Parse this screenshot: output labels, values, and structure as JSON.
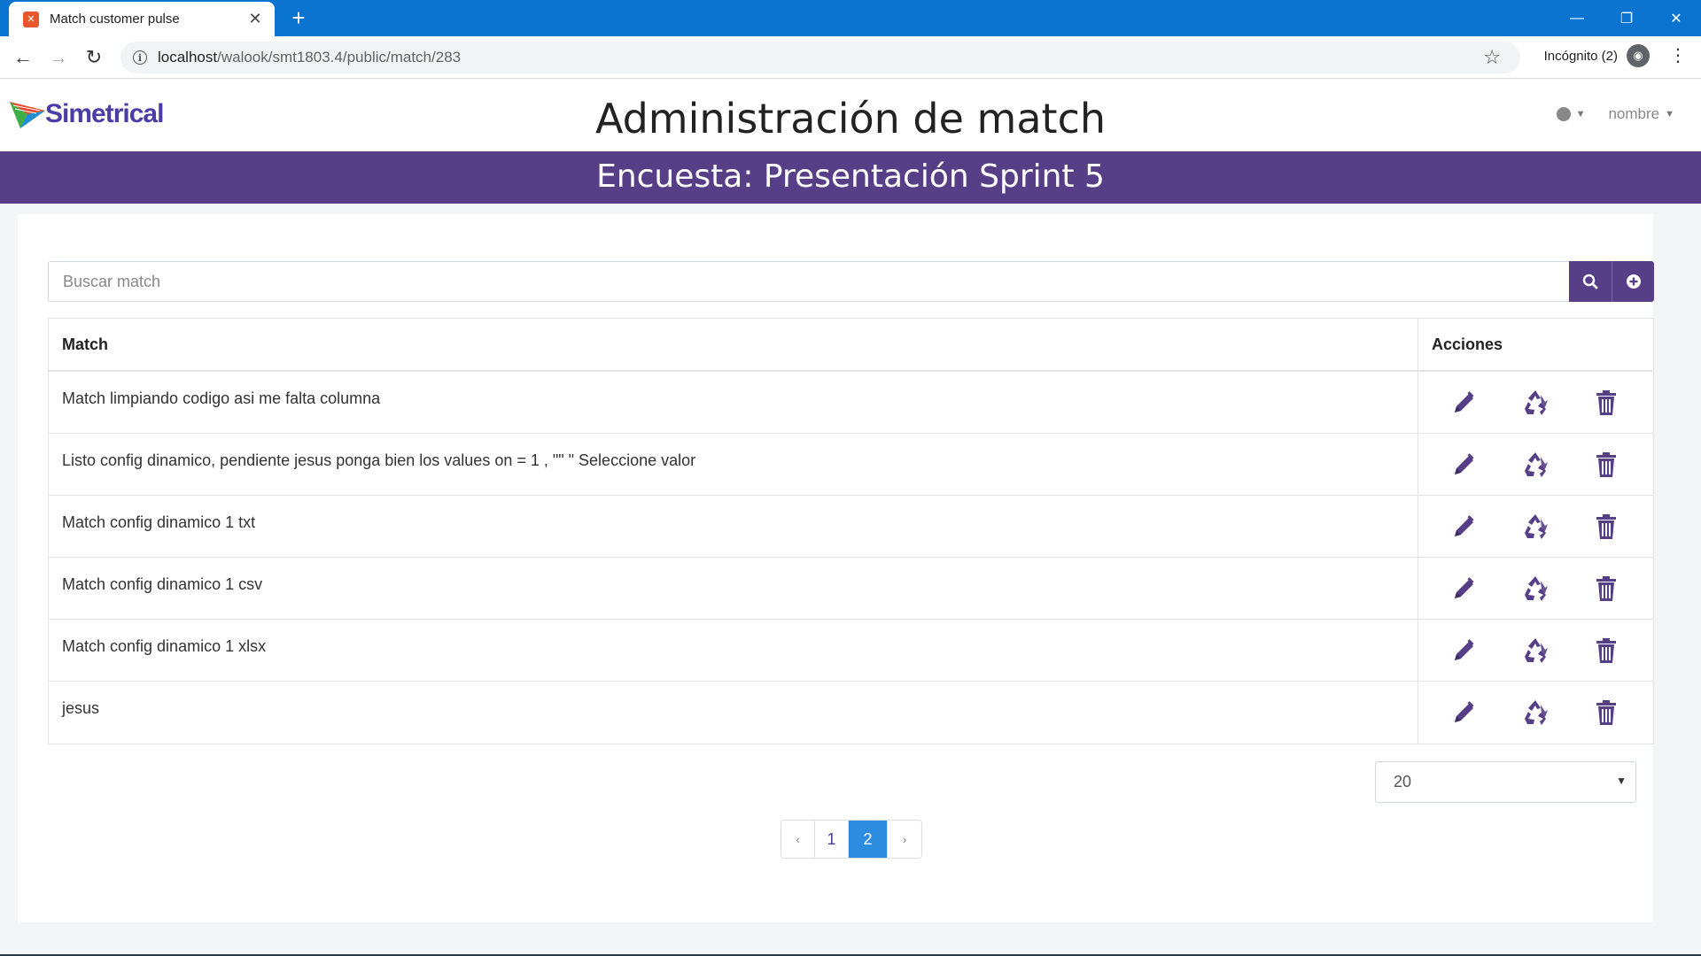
{
  "browser": {
    "tab_title": "Match customer pulse",
    "url_host": "localhost",
    "url_path": "/walook/smt1803.4/public/match/283",
    "incognito_label": "Incógnito (2)"
  },
  "header": {
    "logo_text": "Simetrical",
    "title": "Administración de match",
    "user_label": "nombre"
  },
  "banner": {
    "text": "Encuesta: Presentación Sprint 5"
  },
  "search": {
    "placeholder": "Buscar match"
  },
  "table": {
    "col_match": "Match",
    "col_actions": "Acciones",
    "rows": [
      "Match limpiando codigo asi me falta columna",
      "Listo config dinamico, pendiente jesus ponga bien los values on = 1 , \"\" \" Seleccione valor",
      "Match config dinamico 1 txt",
      "Match config dinamico 1 csv",
      "Match config dinamico 1 xlsx",
      "jesus"
    ]
  },
  "pager": {
    "page_size": "20",
    "prev": "‹",
    "next": "›",
    "pages": [
      "1",
      "2"
    ],
    "current_page": "2"
  },
  "colors": {
    "brand_purple": "#573f88",
    "chrome_blue": "#0a74d0",
    "active_page": "#2b8ce0"
  }
}
